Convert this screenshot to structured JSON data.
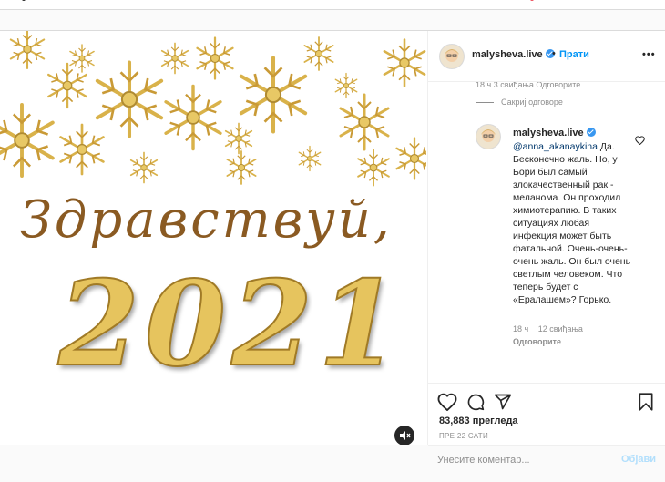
{
  "header": {
    "username": "malysheva.live",
    "separator": "•",
    "follow_label": "Прати",
    "more_label": "•••"
  },
  "image": {
    "greeting": "Здравствуй,",
    "year": "2021",
    "colors": {
      "gold": "#d9b24a",
      "greeting": "#8a5a22"
    }
  },
  "comments": {
    "top_meta": "18 ч   3 свиђања   Одговорите",
    "hide_replies": "Сакриј одговоре",
    "reply": {
      "username": "malysheva.live",
      "mention": "@anna_akanaykina",
      "text_after_mention": " Да. Бесконечно жаль. Но, у Бори был самый злокачественный рак - меланома. Он проходил химиотерапию. В таких ситуациях любая инфекция может быть фатальной. Очень-очень-очень жаль. Он был очень светлым человеком. Что теперь будет с «Ералашем»? Горько.",
      "time": "18 ч",
      "likes": "12 свиђања",
      "reply_label": "Одговорите"
    }
  },
  "actions": {
    "views": "83,883 прегледа",
    "date": "ПРЕ 22 САТИ"
  },
  "comment_box": {
    "placeholder": "Унесите коментар...",
    "post_label": "Објави"
  },
  "icons": {
    "like": "heart-icon",
    "comment": "comment-icon",
    "share": "share-icon",
    "save": "bookmark-icon",
    "mute": "audio-muted-icon",
    "verified": "verified-badge-icon"
  },
  "colors": {
    "accent": "#0095f6",
    "text": "#262626",
    "muted": "#8e8e8e"
  }
}
